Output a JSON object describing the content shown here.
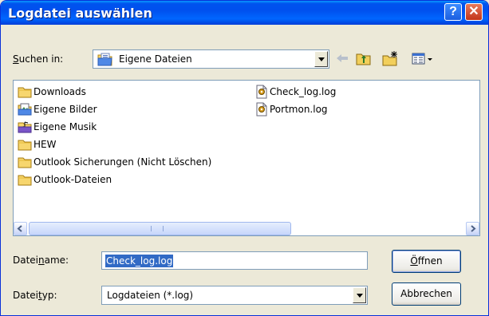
{
  "window": {
    "title": "Logdatei auswählen",
    "help": "?",
    "close": "✕"
  },
  "look_in": {
    "label_pre": "S",
    "label_rest": "uchen in:",
    "value": "Eigene Dateien"
  },
  "files": [
    {
      "name": "Downloads",
      "icon": "folder-icon"
    },
    {
      "name": "Eigene Bilder",
      "icon": "pictures-folder-icon"
    },
    {
      "name": "Eigene Musik",
      "icon": "music-folder-icon"
    },
    {
      "name": "HEW",
      "icon": "folder-icon"
    },
    {
      "name": "Outlook Sicherungen (Nicht Löschen)",
      "icon": "folder-icon"
    },
    {
      "name": "Outlook-Dateien",
      "icon": "folder-icon"
    },
    {
      "name": "Check_log.log",
      "icon": "log-file-icon"
    },
    {
      "name": "Portmon.log",
      "icon": "log-file-icon"
    }
  ],
  "filename": {
    "label_pre": "Datei",
    "label_u": "n",
    "label_post": "ame:",
    "value": "Check_log.log"
  },
  "filetype": {
    "label_pre": "Datei",
    "label_u": "t",
    "label_post": "yp:",
    "value": "Logdateien (*.log)"
  },
  "buttons": {
    "open_u": "Ö",
    "open_rest": "ffnen",
    "cancel": "Abbrechen"
  }
}
